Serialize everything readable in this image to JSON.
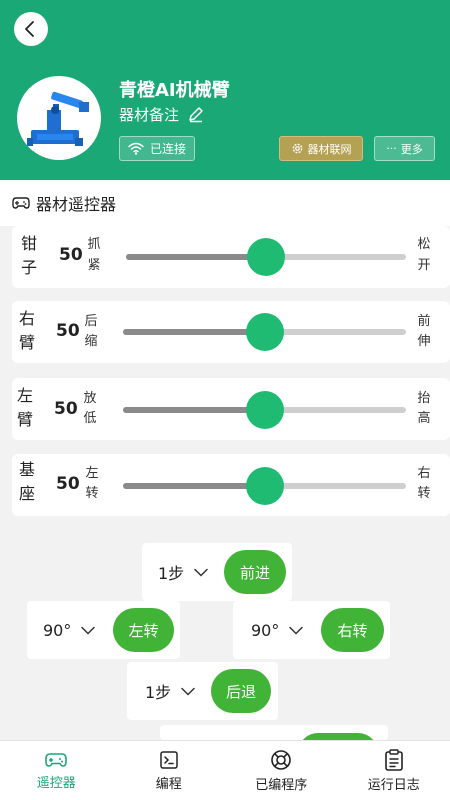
{
  "device": {
    "title": "青橙AI机械臂",
    "note": "器材备注",
    "status": "已连接",
    "iot_label": "器材联网",
    "more_label": "更多",
    "more_dots": "···"
  },
  "section": {
    "title": "器材遥控器"
  },
  "sliders": [
    {
      "label_top": "钳",
      "label_bottom": "子",
      "value": "50",
      "min_top": "抓",
      "min_bottom": "紧",
      "max_top": "松",
      "max_bottom": "开",
      "fraction": 0.5
    },
    {
      "label_top": "右",
      "label_bottom": "臂",
      "value": "50",
      "min_top": "后",
      "min_bottom": "缩",
      "max_top": "前",
      "max_bottom": "伸",
      "fraction": 0.5
    },
    {
      "label_top": "左",
      "label_bottom": "臂",
      "value": "50",
      "min_top": "放",
      "min_bottom": "低",
      "max_top": "抬",
      "max_bottom": "高",
      "fraction": 0.5
    },
    {
      "label_top": "基",
      "label_bottom": "座",
      "value": "50",
      "min_top": "左",
      "min_bottom": "转",
      "max_top": "右",
      "max_bottom": "转",
      "fraction": 0.5
    }
  ],
  "controls": {
    "forward": {
      "step": "1步",
      "label": "前进"
    },
    "left": {
      "step": "90°",
      "label": "左转"
    },
    "right": {
      "step": "90°",
      "label": "右转"
    },
    "backward": {
      "step": "1步",
      "label": "后退"
    }
  },
  "nav": [
    {
      "label": "遥控器",
      "icon": "gamepad-icon",
      "active": true
    },
    {
      "label": "编程",
      "icon": "terminal-icon",
      "active": false
    },
    {
      "label": "已编程序",
      "icon": "lifebuoy-icon",
      "active": false
    },
    {
      "label": "运行日志",
      "icon": "clipboard-icon",
      "active": false
    }
  ],
  "colors": {
    "brand": "#1aa877",
    "accent_button": "#41b337",
    "thumb": "#1fbb73",
    "iot_button": "#b5a154"
  }
}
